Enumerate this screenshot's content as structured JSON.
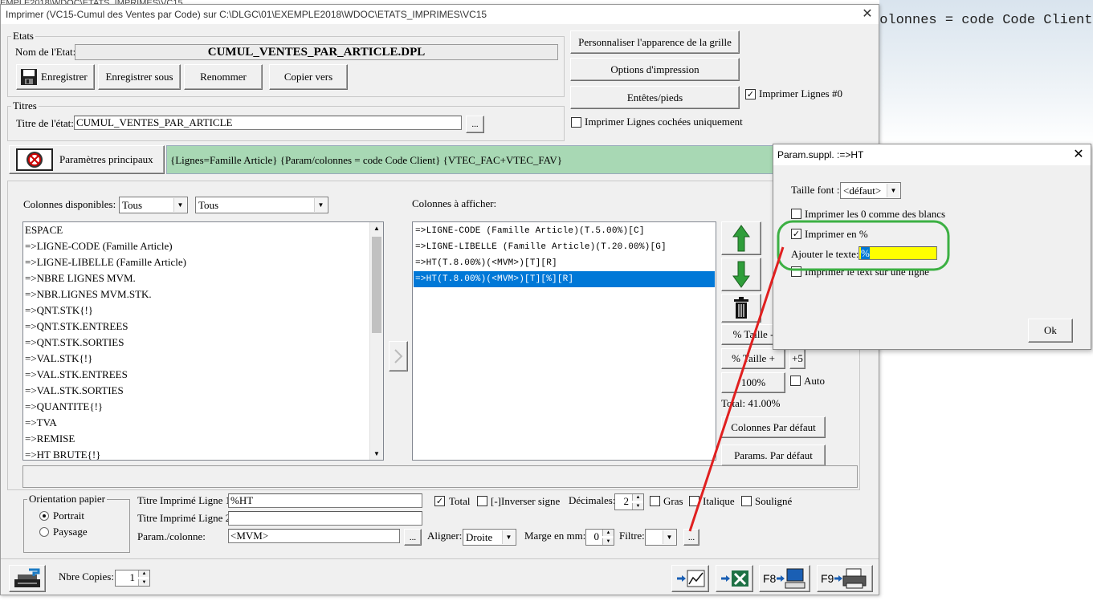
{
  "background": {
    "top_line": "EMPLE2018\\WDOC\\ETATS_IMPRIMES\\VC15",
    "side_text": "colonnes = code Code Client"
  },
  "window": {
    "title": "Imprimer (VC15-Cumul des Ventes par Code)  sur C:\\DLGC\\01\\EXEMPLE2018\\WDOC\\ETATS_IMPRIMES\\VC15",
    "close": "✕"
  },
  "etats": {
    "group_label": "Etats",
    "name_label": "Nom de l'Etat:",
    "name_value": "CUMUL_VENTES_PAR_ARTICLE.DPL",
    "save": "Enregistrer",
    "save_as": "Enregistrer sous",
    "rename": "Renommer",
    "copy_to": "Copier vers"
  },
  "titres": {
    "group_label": "Titres",
    "title_label": "Titre de l'état:",
    "title_value": "CUMUL_VENTES_PAR_ARTICLE",
    "browse": "..."
  },
  "right_buttons": {
    "customize_grid": "Personnaliser l'apparence de la grille",
    "print_options": "Options d'impression",
    "headers_footers": "Entêtes/pieds",
    "print_lines_nonzero": "Imprimer Lignes #0",
    "print_checked_only": "Imprimer Lignes cochées uniquement"
  },
  "params": {
    "main_button": "Paramètres principaux",
    "summary": "{Lignes=Famille Article} {Param/colonnes = code Code Client} {VTEC_FAC+VTEC_FAV}"
  },
  "columns": {
    "available_label": "Colonnes disponibles:",
    "filter1": "Tous",
    "filter2": "Tous",
    "available": [
      "ESPACE",
      "=>LIGNE-CODE (Famille Article)",
      "=>LIGNE-LIBELLE (Famille Article)",
      "=>NBRE LIGNES MVM.",
      "=>NBR.LIGNES MVM.STK.",
      "=>QNT.STK{!}",
      "=>QNT.STK.ENTREES",
      "=>QNT.STK.SORTIES",
      "=>VAL.STK{!}",
      "=>VAL.STK.ENTREES",
      "=>VAL.STK.SORTIES",
      "=>QUANTITE{!}",
      "=>TVA",
      "=>REMISE",
      "=>HT BRUTE{!}"
    ],
    "display_label": "Colonnes à afficher:",
    "displayed": [
      "=>LIGNE-CODE (Famille Article)(T.5.00%)[C]",
      "=>LIGNE-LIBELLE (Famille Article)(T.20.00%)[G]",
      "=>HT(T.8.00%)(<MVM>)[T][R]",
      "=>HT(T.8.00%)(<MVM>)[T][%][R]"
    ],
    "selected_index": 3
  },
  "size_controls": {
    "size_minus": "% Taille -",
    "size_plus": "% Taille +",
    "plus5": "+5",
    "hundred": "100%",
    "auto": "Auto",
    "total": "Total:  41.00%",
    "default_columns": "Colonnes Par défaut",
    "default_params": "Params. Par défaut"
  },
  "orientation": {
    "group_label": "Orientation papier",
    "portrait": "Portrait",
    "landscape": "Paysage"
  },
  "column_props": {
    "title1_label": "Titre Imprimé Ligne 1:",
    "title1_value": "%HT",
    "title2_label": "Titre Imprimé Ligne 2:",
    "title2_value": "",
    "param_label": "Param./colonne:",
    "param_value": "<MVM>",
    "browse": "...",
    "total": "Total",
    "invert_sign": "[-]Inverser signe",
    "decimals_label": "Décimales:",
    "decimals_value": "2",
    "bold": "Gras",
    "italic": "Italique",
    "underline": "Souligné",
    "align_label": "Aligner:",
    "align_value": "Droite",
    "margin_label": "Marge en mm:",
    "margin_value": "0",
    "filter_label": "Filtre:",
    "filter_value": "",
    "extra": "..."
  },
  "bottom": {
    "copies_label": "Nbre Copies:",
    "copies_value": "1",
    "f8": "F8",
    "f9": "F9"
  },
  "param_dialog": {
    "title": "Param.suppl. :=>HT",
    "close": "✕",
    "font_size_label": "Taille font :",
    "font_size_value": "<défaut>",
    "zero_blank": "Imprimer les 0 comme des blancs",
    "print_percent": "Imprimer en %",
    "add_text_label": "Ajouter le texte:",
    "add_text_value": "%",
    "single_line": "Imprimer le text sur une ligne",
    "ok": "Ok"
  },
  "colors": {
    "highlight_circle": "#3cb043",
    "arrow_line": "#e02020",
    "selection": "#0078d7",
    "params_bar": "#a8d8b4",
    "input_highlight": "#ffff00"
  }
}
